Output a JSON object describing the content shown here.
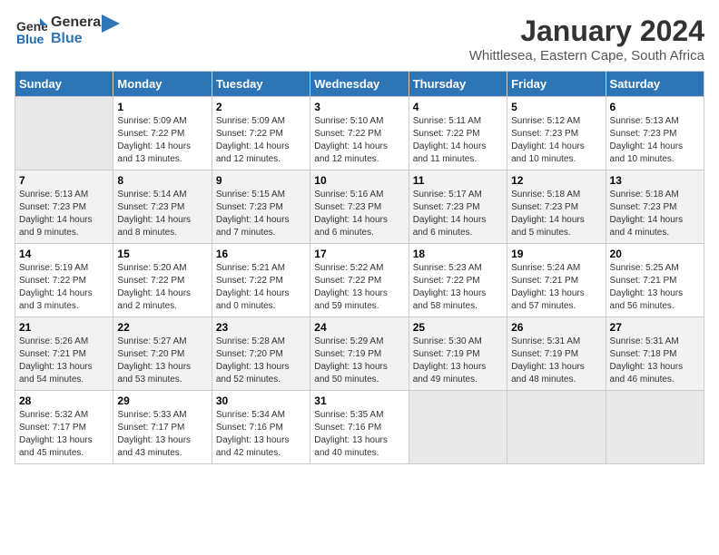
{
  "header": {
    "logo_general": "General",
    "logo_blue": "Blue",
    "title": "January 2024",
    "subtitle": "Whittlesea, Eastern Cape, South Africa"
  },
  "columns": [
    "Sunday",
    "Monday",
    "Tuesday",
    "Wednesday",
    "Thursday",
    "Friday",
    "Saturday"
  ],
  "weeks": [
    [
      {
        "num": "",
        "info": ""
      },
      {
        "num": "1",
        "info": "Sunrise: 5:09 AM\nSunset: 7:22 PM\nDaylight: 14 hours\nand 13 minutes."
      },
      {
        "num": "2",
        "info": "Sunrise: 5:09 AM\nSunset: 7:22 PM\nDaylight: 14 hours\nand 12 minutes."
      },
      {
        "num": "3",
        "info": "Sunrise: 5:10 AM\nSunset: 7:22 PM\nDaylight: 14 hours\nand 12 minutes."
      },
      {
        "num": "4",
        "info": "Sunrise: 5:11 AM\nSunset: 7:22 PM\nDaylight: 14 hours\nand 11 minutes."
      },
      {
        "num": "5",
        "info": "Sunrise: 5:12 AM\nSunset: 7:23 PM\nDaylight: 14 hours\nand 10 minutes."
      },
      {
        "num": "6",
        "info": "Sunrise: 5:13 AM\nSunset: 7:23 PM\nDaylight: 14 hours\nand 10 minutes."
      }
    ],
    [
      {
        "num": "7",
        "info": "Sunrise: 5:13 AM\nSunset: 7:23 PM\nDaylight: 14 hours\nand 9 minutes."
      },
      {
        "num": "8",
        "info": "Sunrise: 5:14 AM\nSunset: 7:23 PM\nDaylight: 14 hours\nand 8 minutes."
      },
      {
        "num": "9",
        "info": "Sunrise: 5:15 AM\nSunset: 7:23 PM\nDaylight: 14 hours\nand 7 minutes."
      },
      {
        "num": "10",
        "info": "Sunrise: 5:16 AM\nSunset: 7:23 PM\nDaylight: 14 hours\nand 6 minutes."
      },
      {
        "num": "11",
        "info": "Sunrise: 5:17 AM\nSunset: 7:23 PM\nDaylight: 14 hours\nand 6 minutes."
      },
      {
        "num": "12",
        "info": "Sunrise: 5:18 AM\nSunset: 7:23 PM\nDaylight: 14 hours\nand 5 minutes."
      },
      {
        "num": "13",
        "info": "Sunrise: 5:18 AM\nSunset: 7:23 PM\nDaylight: 14 hours\nand 4 minutes."
      }
    ],
    [
      {
        "num": "14",
        "info": "Sunrise: 5:19 AM\nSunset: 7:22 PM\nDaylight: 14 hours\nand 3 minutes."
      },
      {
        "num": "15",
        "info": "Sunrise: 5:20 AM\nSunset: 7:22 PM\nDaylight: 14 hours\nand 2 minutes."
      },
      {
        "num": "16",
        "info": "Sunrise: 5:21 AM\nSunset: 7:22 PM\nDaylight: 14 hours\nand 0 minutes."
      },
      {
        "num": "17",
        "info": "Sunrise: 5:22 AM\nSunset: 7:22 PM\nDaylight: 13 hours\nand 59 minutes."
      },
      {
        "num": "18",
        "info": "Sunrise: 5:23 AM\nSunset: 7:22 PM\nDaylight: 13 hours\nand 58 minutes."
      },
      {
        "num": "19",
        "info": "Sunrise: 5:24 AM\nSunset: 7:21 PM\nDaylight: 13 hours\nand 57 minutes."
      },
      {
        "num": "20",
        "info": "Sunrise: 5:25 AM\nSunset: 7:21 PM\nDaylight: 13 hours\nand 56 minutes."
      }
    ],
    [
      {
        "num": "21",
        "info": "Sunrise: 5:26 AM\nSunset: 7:21 PM\nDaylight: 13 hours\nand 54 minutes."
      },
      {
        "num": "22",
        "info": "Sunrise: 5:27 AM\nSunset: 7:20 PM\nDaylight: 13 hours\nand 53 minutes."
      },
      {
        "num": "23",
        "info": "Sunrise: 5:28 AM\nSunset: 7:20 PM\nDaylight: 13 hours\nand 52 minutes."
      },
      {
        "num": "24",
        "info": "Sunrise: 5:29 AM\nSunset: 7:19 PM\nDaylight: 13 hours\nand 50 minutes."
      },
      {
        "num": "25",
        "info": "Sunrise: 5:30 AM\nSunset: 7:19 PM\nDaylight: 13 hours\nand 49 minutes."
      },
      {
        "num": "26",
        "info": "Sunrise: 5:31 AM\nSunset: 7:19 PM\nDaylight: 13 hours\nand 48 minutes."
      },
      {
        "num": "27",
        "info": "Sunrise: 5:31 AM\nSunset: 7:18 PM\nDaylight: 13 hours\nand 46 minutes."
      }
    ],
    [
      {
        "num": "28",
        "info": "Sunrise: 5:32 AM\nSunset: 7:17 PM\nDaylight: 13 hours\nand 45 minutes."
      },
      {
        "num": "29",
        "info": "Sunrise: 5:33 AM\nSunset: 7:17 PM\nDaylight: 13 hours\nand 43 minutes."
      },
      {
        "num": "30",
        "info": "Sunrise: 5:34 AM\nSunset: 7:16 PM\nDaylight: 13 hours\nand 42 minutes."
      },
      {
        "num": "31",
        "info": "Sunrise: 5:35 AM\nSunset: 7:16 PM\nDaylight: 13 hours\nand 40 minutes."
      },
      {
        "num": "",
        "info": ""
      },
      {
        "num": "",
        "info": ""
      },
      {
        "num": "",
        "info": ""
      }
    ]
  ]
}
